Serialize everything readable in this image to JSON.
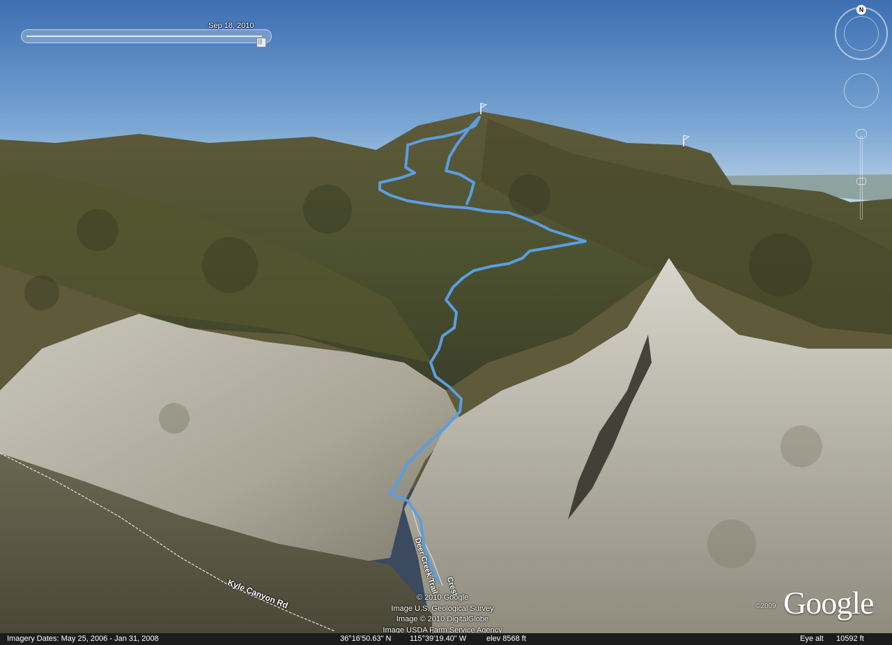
{
  "time_slider": {
    "date_label": "Sep 18, 2010"
  },
  "navigation": {
    "compass_label": "N"
  },
  "map_labels": {
    "trail_1": "Deer Creek Trail",
    "trail_2": "Crest",
    "road": "Kyle Canyon Rd"
  },
  "credits": [
    "© 2010 Google",
    "Image U.S. Geological Survey",
    "Image © 2010 DigitalGlobe",
    "Image USDA Farm Service Agency"
  ],
  "logo": {
    "text": "Google",
    "copyright": "©2009"
  },
  "status_bar": {
    "imagery_dates": "Imagery Dates: May 25, 2006 - Jan 31, 2008",
    "latitude": "36°16'50.63\" N",
    "longitude": "115°39'19.40\" W",
    "elevation": "elev  8568 ft",
    "eye_alt_label": "Eye alt",
    "eye_alt_value": "10592 ft"
  },
  "colors": {
    "track": "#5a9ee0",
    "sky_top": "#3d6fb2",
    "sky_bottom": "#bcd3e6"
  }
}
